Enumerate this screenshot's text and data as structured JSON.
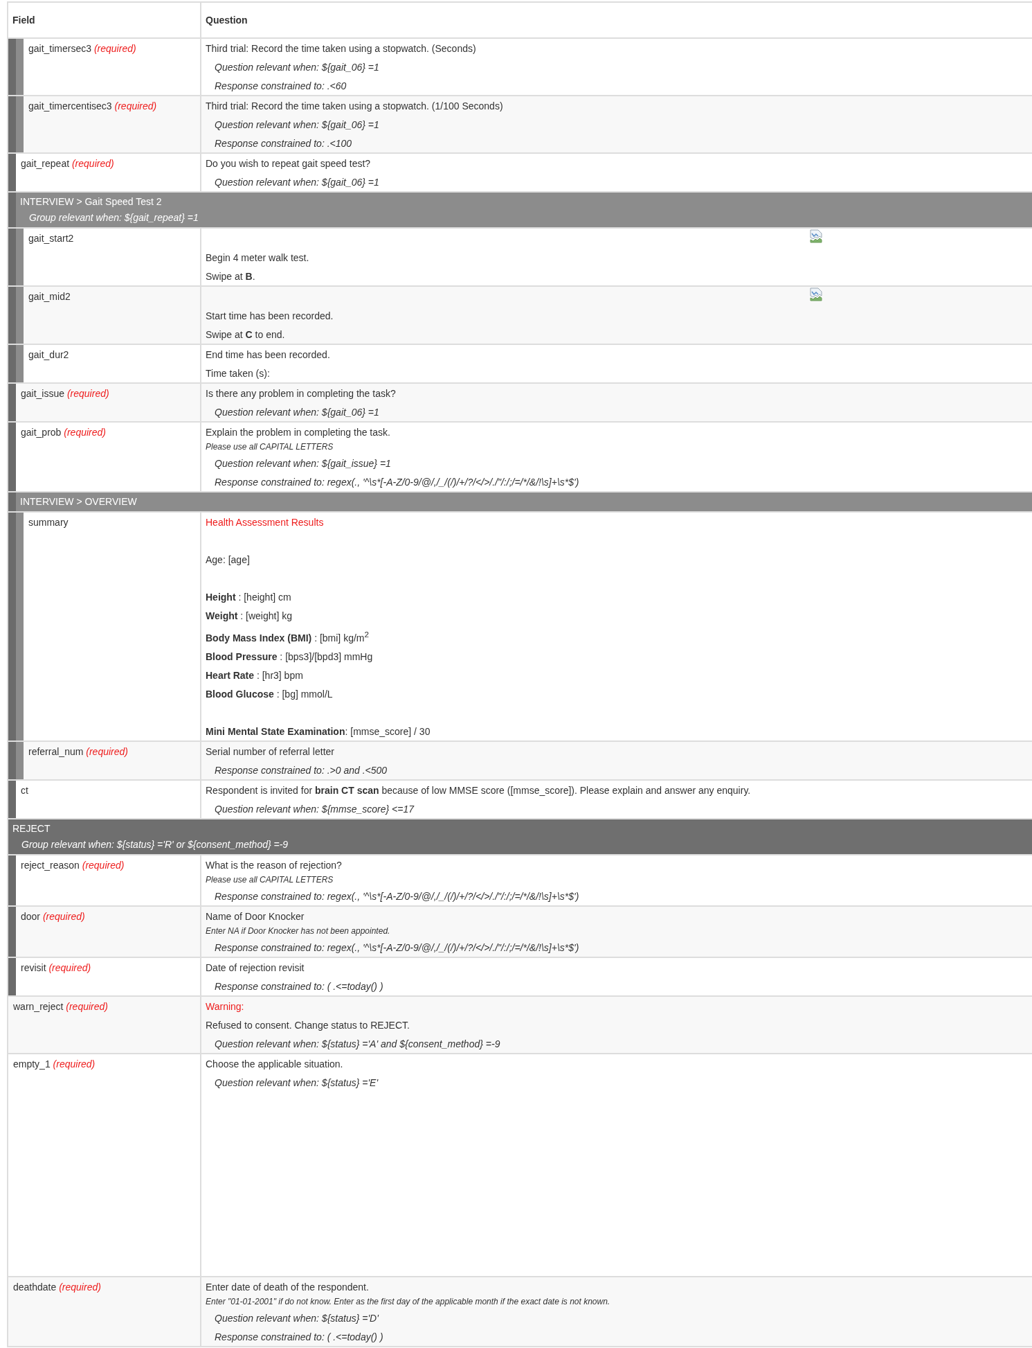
{
  "table": {
    "columns": [
      "Field",
      "Question"
    ],
    "rows": [
      {
        "kind": "group",
        "children": [
          {
            "kind": "group",
            "children": [
              {
                "kind": "field",
                "name": "gait_timersec3",
                "tag": "(required)",
                "lines": [
                  {
                    "kind": "text",
                    "text": "Third trial: Record the time taken using a stopwatch. (Seconds)"
                  },
                  {
                    "kind": "relevant",
                    "text": "Question relevant when: ${gait_06} =1"
                  },
                  {
                    "kind": "constraint",
                    "text": "Response constrained to: .<60"
                  }
                ]
              },
              {
                "kind": "field",
                "name": "gait_timercentisec3",
                "tag": "(required)",
                "lines": [
                  {
                    "kind": "text",
                    "text": "Third trial: Record the time taken using a stopwatch. (1/100 Seconds)"
                  },
                  {
                    "kind": "relevant",
                    "text": "Question relevant when: ${gait_06} =1"
                  },
                  {
                    "kind": "constraint",
                    "text": "Response constrained to: .<100"
                  }
                ]
              }
            ]
          },
          {
            "kind": "field",
            "name": "gait_repeat",
            "tag": "(required)",
            "lines": [
              {
                "kind": "text",
                "text": "Do you wish to repeat gait speed test?"
              },
              {
                "kind": "relevant",
                "text": "Question relevant when: ${gait_06} =1"
              }
            ]
          },
          {
            "kind": "group",
            "title": "INTERVIEW > Gait Speed Test 2",
            "relevant": "Group relevant when: ${gait_repeat} =1",
            "children": [
              {
                "kind": "field",
                "name": "gait_start2",
                "lines": [
                  {
                    "kind": "image"
                  },
                  {
                    "kind": "text",
                    "text": "Begin 4 meter walk test."
                  },
                  {
                    "kind": "text",
                    "text": "Swipe at **B**."
                  }
                ]
              },
              {
                "kind": "field",
                "name": "gait_mid2",
                "lines": [
                  {
                    "kind": "image"
                  },
                  {
                    "kind": "text",
                    "text": "Start time has been recorded."
                  },
                  {
                    "kind": "text",
                    "text": "Swipe at **C** to end."
                  }
                ]
              },
              {
                "kind": "field",
                "name": "gait_dur2",
                "lines": [
                  {
                    "kind": "text",
                    "text": "End time has been recorded."
                  },
                  {
                    "kind": "text",
                    "text": "Time taken (s):"
                  }
                ]
              }
            ]
          },
          {
            "kind": "field",
            "name": "gait_issue",
            "tag": "(required)",
            "lines": [
              {
                "kind": "text",
                "text": "Is there any problem in completing the task?"
              },
              {
                "kind": "relevant",
                "text": "Question relevant when: ${gait_06} =1"
              }
            ]
          },
          {
            "kind": "field",
            "name": "gait_prob",
            "tag": "(required)",
            "lines": [
              {
                "kind": "text",
                "text": "Explain the problem in completing the task."
              },
              {
                "kind": "hint",
                "text": "Please use all CAPITAL LETTERS"
              },
              {
                "kind": "relevant",
                "text": "Question relevant when: ${gait_issue} =1"
              },
              {
                "kind": "constraint",
                "text": "Response constrained to: regex(., '^\\s*[-A-Z/0-9/@/,/_/(/)/+/?/</>/./\"/:/;/=/*/&/!\\s]+\\s*$')"
              }
            ]
          },
          {
            "kind": "group",
            "title": "INTERVIEW > OVERVIEW",
            "children": [
              {
                "kind": "field",
                "name": "summary",
                "lines": [
                  {
                    "kind": "title",
                    "text": "Health Assessment Results"
                  },
                  {
                    "kind": "text",
                    "text": "Age: [age]",
                    "space_before": true
                  },
                  {
                    "kind": "text",
                    "text": "**Height** : [height] cm",
                    "space_before": true
                  },
                  {
                    "kind": "text",
                    "text": "**Weight** : [weight] kg"
                  },
                  {
                    "kind": "text",
                    "text": "**Body Mass Index (BMI)** : [bmi] kg/m$^{2}$"
                  },
                  {
                    "kind": "text",
                    "text": "**Blood Pressure** : [bps3]/[bpd3] mmHg"
                  },
                  {
                    "kind": "text",
                    "text": "**Heart Rate** : [hr3] bpm"
                  },
                  {
                    "kind": "text",
                    "text": "**Blood Glucose** : [bg] mmol/L"
                  },
                  {
                    "kind": "text",
                    "text": "**Mini Mental State Examination**: [mmse_score] / 30",
                    "space_before": true
                  }
                ]
              },
              {
                "kind": "field",
                "name": "referral_num",
                "tag": "(required)",
                "lines": [
                  {
                    "kind": "text",
                    "text": "Serial number of referral letter"
                  },
                  {
                    "kind": "constraint",
                    "text": "Response constrained to: .>0 and .<500"
                  }
                ]
              }
            ]
          },
          {
            "kind": "field",
            "name": "ct",
            "lines": [
              {
                "kind": "text",
                "text": "Respondent is invited for **brain CT scan** because of low MMSE score ([mmse_score]). Please explain and answer any enquiry."
              },
              {
                "kind": "relevant",
                "text": "Question relevant when: ${mmse_score} <=17"
              }
            ]
          }
        ]
      },
      {
        "kind": "group",
        "title": "REJECT",
        "relevant": "Group relevant when: ${status} ='R' or ${consent_method} =-9",
        "children": [
          {
            "kind": "field",
            "name": "reject_reason",
            "tag": "(required)",
            "lines": [
              {
                "kind": "text",
                "text": "What is the reason of rejection?"
              },
              {
                "kind": "hint",
                "text": "Please use all CAPITAL LETTERS"
              },
              {
                "kind": "constraint",
                "text": "Response constrained to: regex(., '^\\s*[-A-Z/0-9/@/,/_/(/)/+/?/</>/./\"/:/;/=/*/&/!\\s]+\\s*$')"
              }
            ]
          },
          {
            "kind": "field",
            "name": "door",
            "tag": "(required)",
            "lines": [
              {
                "kind": "text",
                "text": "Name of Door Knocker"
              },
              {
                "kind": "hint",
                "text": "Enter NA if Door Knocker has not been appointed."
              },
              {
                "kind": "constraint",
                "text": "Response constrained to: regex(., '^\\s*[-A-Z/0-9/@/,/_/(/)/+/?/</>/./\"/:/;/=/*/&/!\\s]+\\s*$')"
              }
            ]
          },
          {
            "kind": "field",
            "name": "revisit",
            "tag": "(required)",
            "lines": [
              {
                "kind": "text",
                "text": "Date of rejection revisit"
              },
              {
                "kind": "constraint",
                "text": "Response constrained to: ( .<=today() )"
              }
            ]
          }
        ]
      },
      {
        "kind": "field",
        "name": "warn_reject",
        "tag": "(required)",
        "lines": [
          {
            "kind": "title",
            "text": "Warning:"
          },
          {
            "kind": "text",
            "text": "Refused to consent. Change status to REJECT."
          },
          {
            "kind": "relevant",
            "text": "Question relevant when: ${status} ='A' and ${consent_method} =-9"
          }
        ]
      },
      {
        "kind": "field",
        "name": "empty_1",
        "tag": "(required)",
        "lines": [
          {
            "kind": "text",
            "text": "Choose the applicable situation."
          },
          {
            "kind": "relevant",
            "text": "Question relevant when: ${status} ='E'"
          },
          {
            "kind": "blank"
          }
        ]
      },
      {
        "kind": "field",
        "name": "deathdate",
        "tag": "(required)",
        "lines": [
          {
            "kind": "text",
            "text": "Enter date of death of the respondent."
          },
          {
            "kind": "hint",
            "text": "Enter \"01-01-2001\" if do not know. Enter as the first day of the applicable month if the exact date is not known."
          },
          {
            "kind": "relevant",
            "text": "Question relevant when: ${status} ='D'"
          },
          {
            "kind": "constraint",
            "text": "Response constrained to: ( .<=today() )"
          }
        ]
      }
    ]
  }
}
